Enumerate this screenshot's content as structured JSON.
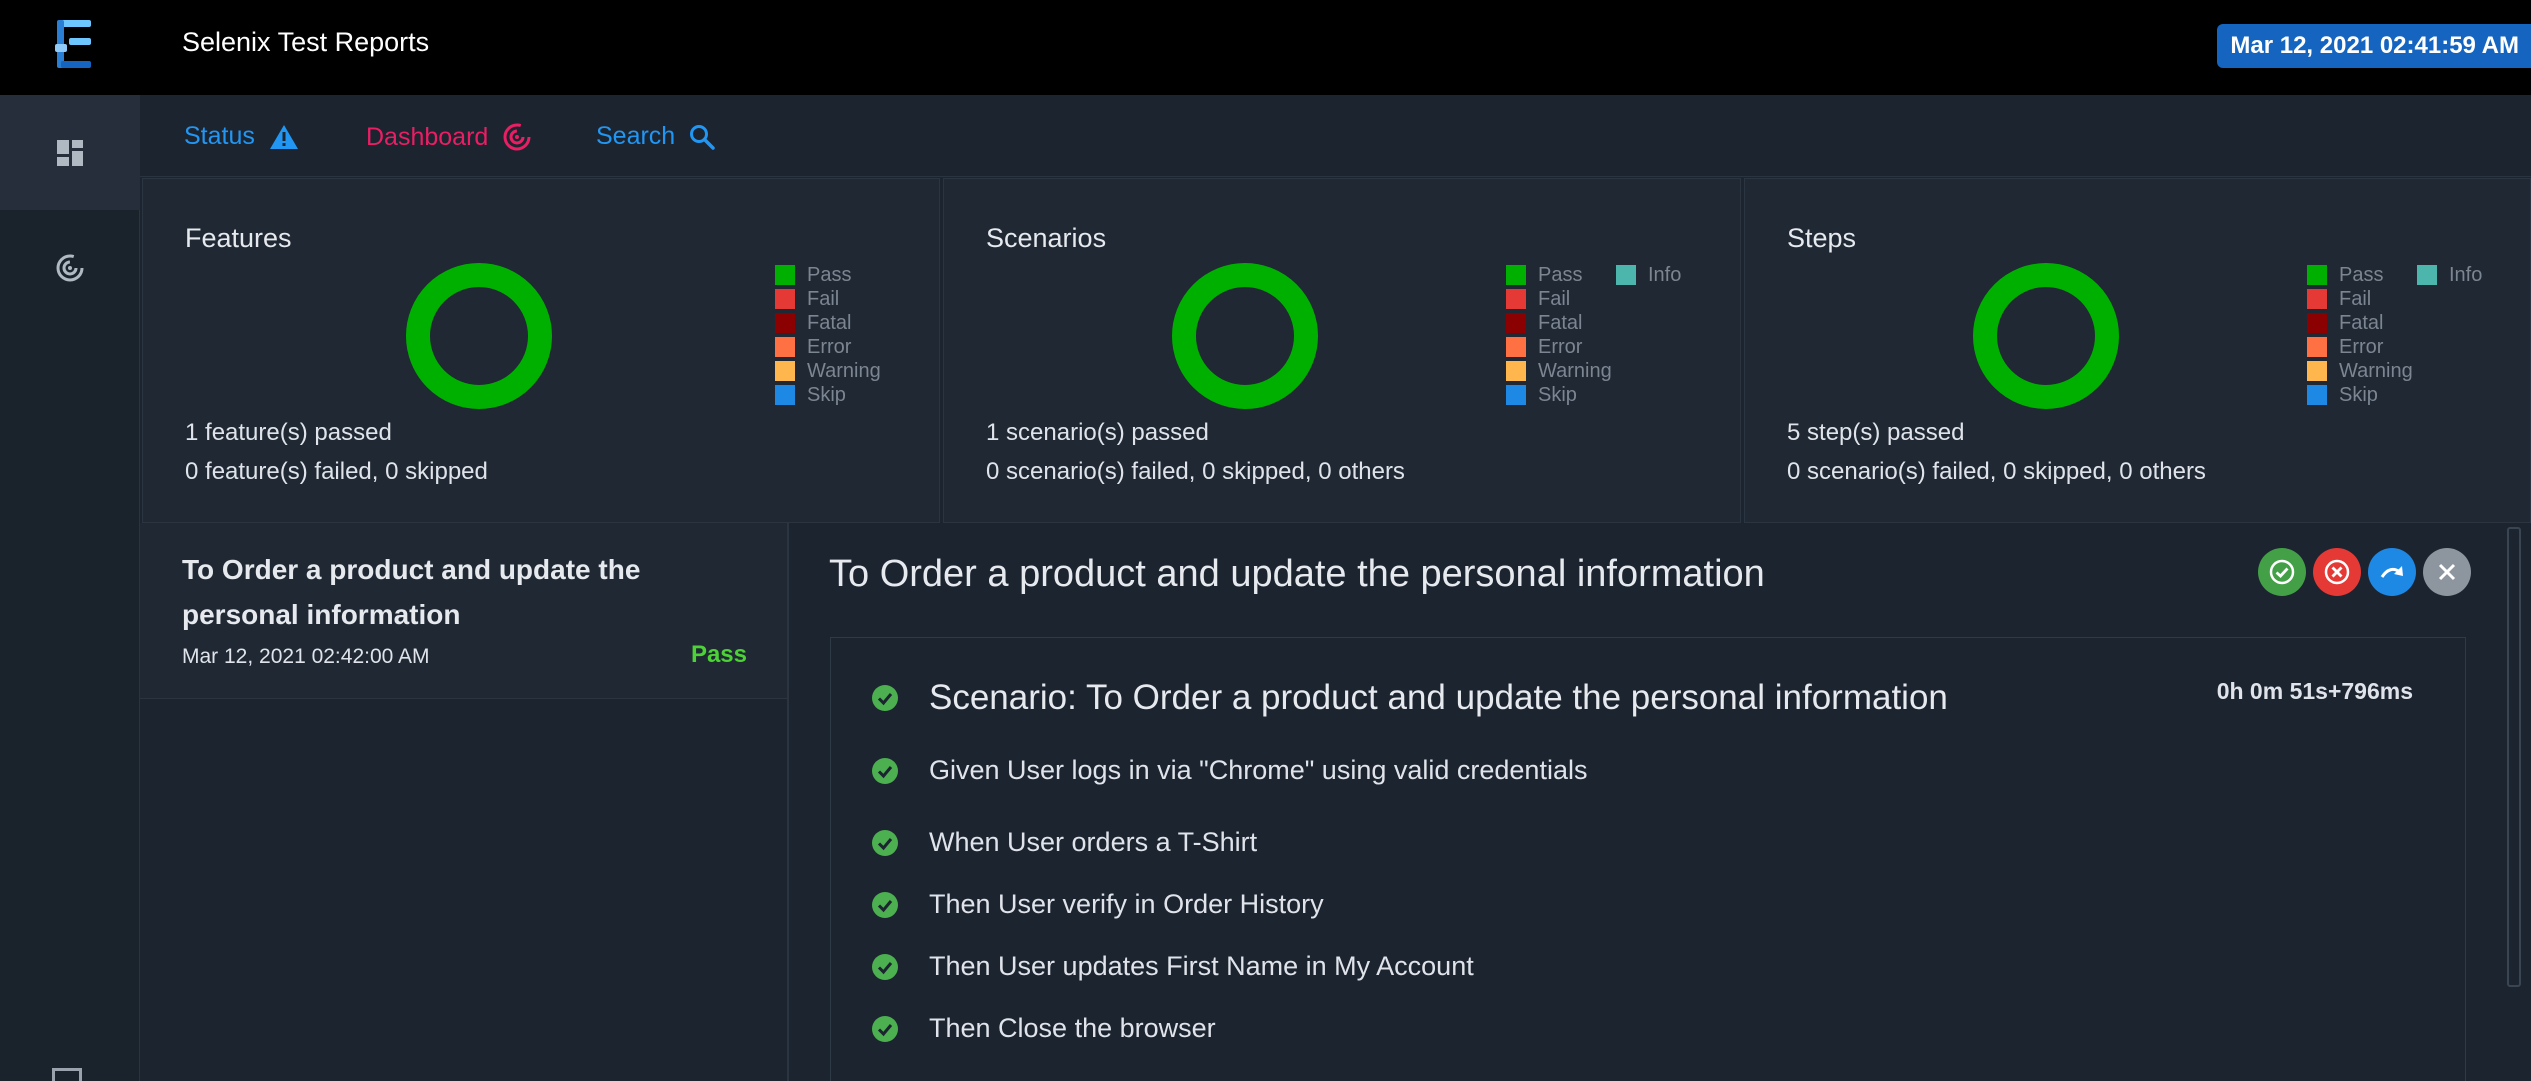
{
  "app": {
    "title": "Selenix Test Reports",
    "date": "Mar 12, 2021 02:41:59 AM"
  },
  "nav": {
    "status": "Status",
    "dashboard": "Dashboard",
    "search": "Search"
  },
  "colors": {
    "pass": "#00b000",
    "fail": "#e53935",
    "fatal": "#8b0000",
    "error": "#ff7043",
    "warning": "#ffb74d",
    "skip": "#1e88e5",
    "info": "#4db6ac",
    "status_link": "#2196f3",
    "dashboard_link": "#e91e63"
  },
  "legend": {
    "pass": "Pass",
    "fail": "Fail",
    "fatal": "Fatal",
    "error": "Error",
    "warning": "Warning",
    "skip": "Skip",
    "info": "Info"
  },
  "cards": {
    "features": {
      "title": "Features",
      "passed_count": "1",
      "passed_label": " feature(s) passed",
      "failed_count": "0",
      "failed_label": " feature(s) failed, ",
      "skipped_count": "0",
      "skipped_label": " skipped"
    },
    "scenarios": {
      "title": "Scenarios",
      "passed_count": "1",
      "passed_label": " scenario(s) passed",
      "failed_count": "0",
      "failed_label": " scenario(s) failed, ",
      "skipped_count": "0",
      "skipped_label": " skipped, ",
      "others_count": "0",
      "others_label": " others"
    },
    "steps": {
      "title": "Steps",
      "passed_count": "5",
      "passed_label": " step(s) passed",
      "failed_count": "0",
      "failed_label": " scenario(s) failed, ",
      "skipped_count": "0",
      "skipped_label": " skipped, ",
      "others_count": "0",
      "others_label": " others"
    }
  },
  "list": {
    "items": [
      {
        "title": "To Order a product and update the personal information",
        "date": "Mar 12, 2021 02:42:00 AM",
        "status": "Pass"
      }
    ]
  },
  "detail": {
    "title": "To Order a product and update the personal information",
    "scenario": "Scenario: To Order a product and update the personal information",
    "duration": "0h 0m 51s+796ms",
    "steps": [
      "Given User logs in via \"Chrome\" using valid credentials",
      "When User orders a T-Shirt",
      "Then User verify in Order History",
      "Then User updates First Name in My Account",
      "Then Close the browser"
    ]
  }
}
